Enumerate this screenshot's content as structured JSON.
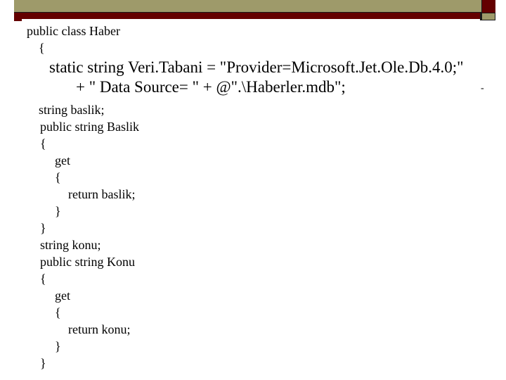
{
  "theme": {
    "olive": "#9E9A6A",
    "red": "#640000"
  },
  "code": {
    "line1": "public class Haber",
    "line2": "{",
    "line3": "static string Veri.Tabani = \"Provider=Microsoft.Jet.Ole.Db.4.0;\"",
    "line4": "+ \" Data Source= \" + @\".\\Haberler.mdb\";",
    "line5": "string baslik;",
    "line6": "public string Baslik",
    "line7": "{",
    "line8": "get",
    "line9": "{",
    "line10": "return baslik;",
    "line11": "}",
    "line12": "}",
    "line13": "string konu;",
    "line14": "public string Konu",
    "line15": "{",
    "line16": "get",
    "line17": "{",
    "line18": "return konu;",
    "line19": "}",
    "line20": "}"
  },
  "trailing_mark": "-"
}
